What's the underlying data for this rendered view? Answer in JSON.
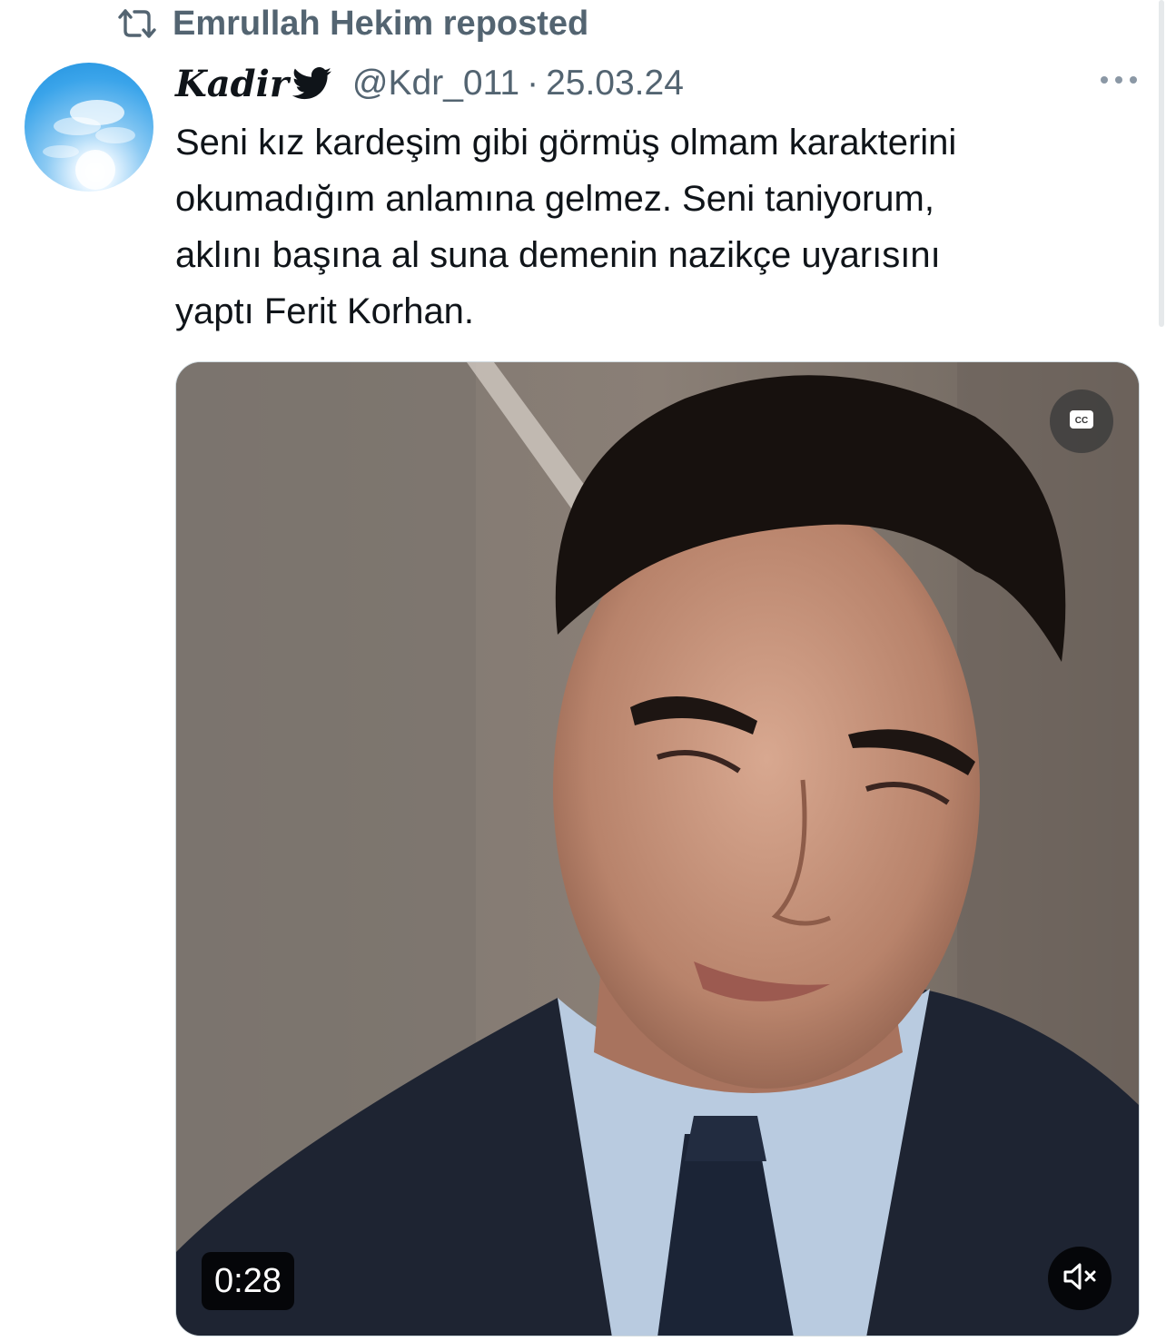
{
  "repost": {
    "label": "Emrullah Hekim reposted"
  },
  "tweet": {
    "author_name": "Kadir",
    "handle": "@Kdr_011",
    "separator": "·",
    "date": "25.03.24",
    "text": "Seni kız kardeşim gibi görmüş olmam karakterini\nokumadığım anlamına gelmez. Seni taniyorum,\naklını başına al suna demenin nazikçe uyarısını\nyaptı Ferit Korhan."
  },
  "video": {
    "duration": "0:28",
    "captions_label": "CC"
  },
  "icons": {
    "repost": "repost-icon",
    "verified_bird": "twitter-bird-icon",
    "more": "more-options-icon",
    "captions": "closed-captions-icon",
    "mute": "muted-speaker-icon"
  },
  "colors": {
    "secondary_text": "#536471",
    "primary_text": "#0f1419",
    "video_overlay": "#000000"
  }
}
